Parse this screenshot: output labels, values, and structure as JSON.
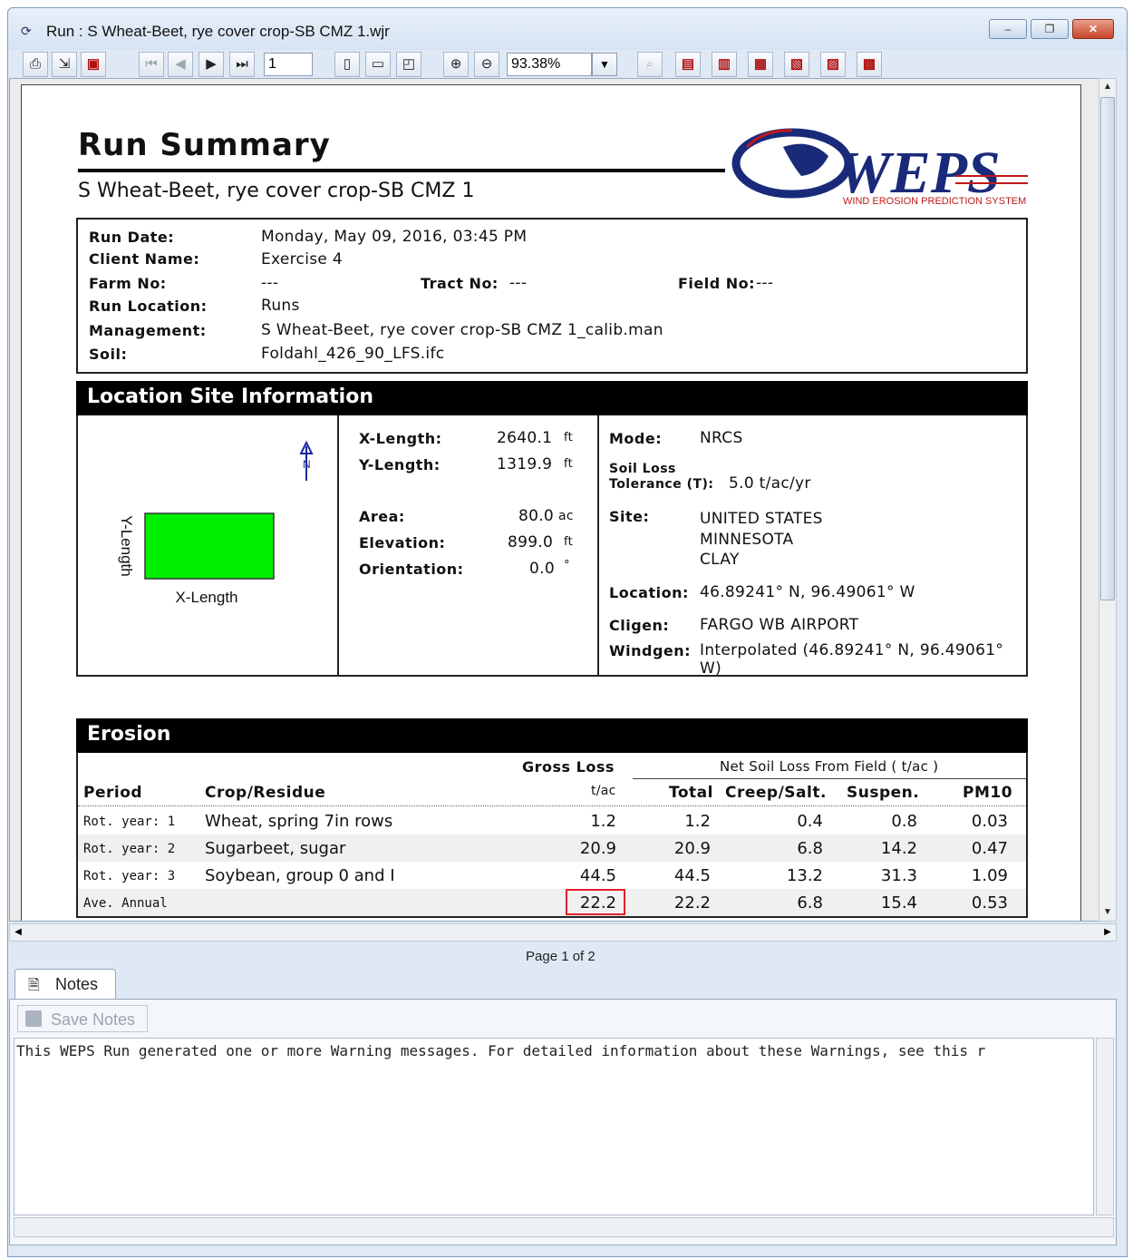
{
  "window": {
    "title": "Run : S Wheat-Beet, rye cover crop-SB CMZ 1.wjr",
    "minimize": "–",
    "restore": "❐",
    "close": "✕"
  },
  "toolbar": {
    "page_value": "1",
    "zoom_value": "93.38%",
    "icons": [
      "print-icon",
      "export-icon",
      "pdf-icon",
      "first-page-icon",
      "prev-page-icon",
      "next-page-icon",
      "last-page-icon",
      "single-page-icon",
      "fit-width-icon",
      "fit-page-icon",
      "zoom-in-icon",
      "zoom-out-icon"
    ]
  },
  "report": {
    "title": "Run Summary",
    "subtitle": "S Wheat-Beet, rye cover crop-SB CMZ 1",
    "logo_text": "WEPS",
    "logo_tagline": "WIND EROSION PREDICTION SYSTEM",
    "info": {
      "run_date_label": "Run Date:",
      "run_date": "Monday, May 09, 2016, 03:45 PM",
      "client_label": "Client Name:",
      "client": "Exercise 4",
      "farm_label": "Farm No:",
      "farm": "---",
      "tract_label": "Tract No:",
      "tract": "---",
      "field_label": "Field No:",
      "field": "---",
      "location_label": "Run Location:",
      "location": "Runs",
      "management_label": "Management:",
      "management": "S Wheat-Beet, rye cover crop-SB CMZ 1_calib.man",
      "soil_label": "Soil:",
      "soil": "Foldahl_426_90_LFS.ifc"
    },
    "location_site": {
      "header": "Location Site Information",
      "ylength_axis": "Y-Length",
      "xlength_axis": "X-Length",
      "north": "N",
      "x_length_label": "X-Length:",
      "x_length": "2640.1",
      "x_length_unit": "ft",
      "y_length_label": "Y-Length:",
      "y_length": "1319.9",
      "y_length_unit": "ft",
      "area_label": "Area:",
      "area": "80.0",
      "area_unit": "ac",
      "elevation_label": "Elevation:",
      "elevation": "899.0",
      "elevation_unit": "ft",
      "orientation_label": "Orientation:",
      "orientation": "0.0",
      "orientation_unit": "°",
      "mode_label": "Mode:",
      "mode": "NRCS",
      "tolerance_label_1": "Soil Loss",
      "tolerance_label_2": "Tolerance (T):",
      "tolerance": "5.0 t/ac/yr",
      "site_label": "Site:",
      "site_1": "UNITED STATES",
      "site_2": "MINNESOTA",
      "site_3": "CLAY",
      "loc_label": "Location:",
      "loc": "46.89241° N, 96.49061° W",
      "cligen_label": "Cligen:",
      "cligen": "FARGO WB AIRPORT",
      "windgen_label": "Windgen:",
      "windgen": "Interpolated (46.89241° N, 96.49061° W)"
    },
    "erosion": {
      "header": "Erosion",
      "gross_loss": "Gross Loss",
      "gross_unit": "t/ac",
      "net_header": "Net Soil Loss From Field ( t/ac )",
      "col_period": "Period",
      "col_crop": "Crop/Residue",
      "col_total": "Total",
      "col_creep": "Creep/Salt.",
      "col_suspen": "Suspen.",
      "col_pm10": "PM10",
      "rows": [
        {
          "period": "Rot. year: 1",
          "crop": "Wheat, spring 7in rows",
          "gross": "1.2",
          "total": "1.2",
          "creep": "0.4",
          "suspen": "0.8",
          "pm10": "0.03"
        },
        {
          "period": "Rot. year: 2",
          "crop": "Sugarbeet, sugar",
          "gross": "20.9",
          "total": "20.9",
          "creep": "6.8",
          "suspen": "14.2",
          "pm10": "0.47"
        },
        {
          "period": "Rot. year: 3",
          "crop": "Soybean, group 0 and I",
          "gross": "44.5",
          "total": "44.5",
          "creep": "13.2",
          "suspen": "31.3",
          "pm10": "1.09"
        },
        {
          "period": "Ave. Annual",
          "crop": "",
          "gross": "22.2",
          "total": "22.2",
          "creep": "6.8",
          "suspen": "15.4",
          "pm10": "0.53"
        }
      ]
    }
  },
  "page_label": "Page 1 of 2",
  "notes": {
    "tab": "Notes",
    "save_button": "Save Notes",
    "text": "This WEPS Run generated one or more Warning messages. For detailed information about these Warnings, see this r"
  },
  "colors": {
    "field_green": "#00ee00",
    "highlight": "#e0202a",
    "north_arrow": "#1a2a9a"
  }
}
